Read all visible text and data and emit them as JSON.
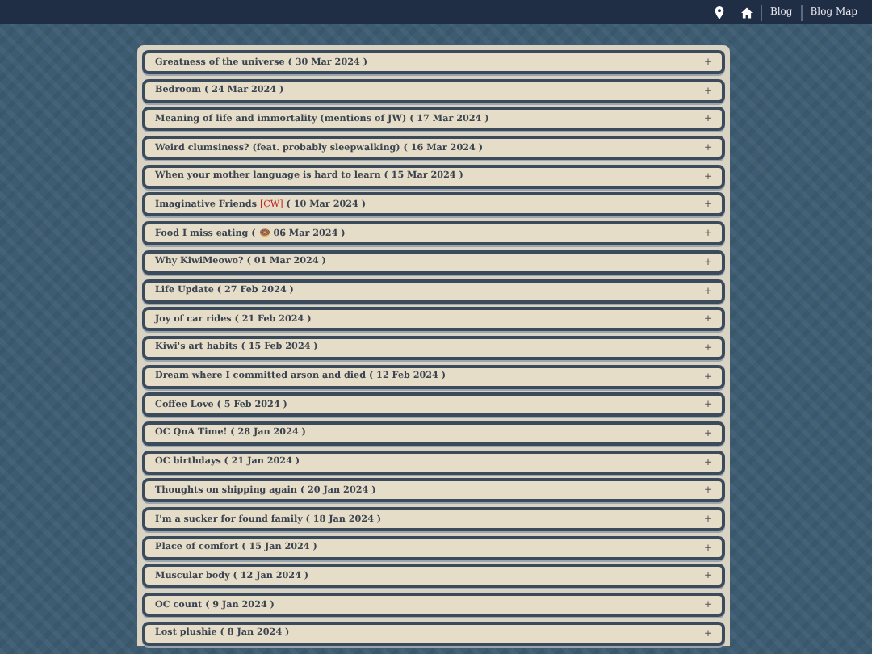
{
  "nav": {
    "links": [
      "Blog",
      "Blog Map"
    ]
  },
  "posts": [
    {
      "title": "Greatness of the universe",
      "date": "( 30 Mar 2024 )",
      "toggle": "+"
    },
    {
      "title": "Bedroom",
      "date": "( 24 Mar 2024 )",
      "toggle": "+"
    },
    {
      "title": "Meaning of life and immortality (mentions of JW)",
      "date": "( 17 Mar 2024 )",
      "toggle": "+"
    },
    {
      "title": "Weird clumsiness? (feat. probably sleepwalking)",
      "date": "( 16 Mar 2024 )",
      "toggle": "+"
    },
    {
      "title": "When your mother language is hard to learn",
      "date": "( 15 Mar 2024 )",
      "toggle": "+"
    },
    {
      "title": "Imaginative Friends",
      "tag": "[CW]",
      "date": "( 10 Mar 2024 )",
      "toggle": "+"
    },
    {
      "title": "Food I miss eating",
      "date": "( 🍩 06 Mar 2024 )",
      "toggle": "+"
    },
    {
      "title": "Why KiwiMeowo?",
      "date": "( 01 Mar 2024 )",
      "toggle": "+"
    },
    {
      "title": "Life Update",
      "date": "( 27 Feb 2024 )",
      "toggle": "+"
    },
    {
      "title": "Joy of car rides",
      "date": "( 21 Feb 2024 )",
      "toggle": "+"
    },
    {
      "title": "Kiwi's art habits",
      "date": "( 15 Feb 2024 )",
      "toggle": "+"
    },
    {
      "title": "Dream where I committed arson and died",
      "date": "( 12 Feb 2024 )",
      "toggle": "+"
    },
    {
      "title": "Coffee Love",
      "date": "( 5 Feb 2024 )",
      "toggle": "+"
    },
    {
      "title": "OC QnA Time!",
      "date": "( 28 Jan 2024 )",
      "toggle": "+"
    },
    {
      "title": "OC birthdays",
      "date": "( 21 Jan 2024 )",
      "toggle": "+"
    },
    {
      "title": "Thoughts on shipping again",
      "date": "( 20 Jan 2024 )",
      "toggle": "+"
    },
    {
      "title": "I'm a sucker for found family",
      "date": "( 18 Jan 2024 )",
      "toggle": "+"
    },
    {
      "title": "Place of comfort",
      "date": "( 15 Jan 2024 )",
      "toggle": "+"
    },
    {
      "title": "Muscular body",
      "date": "( 12 Jan 2024 )",
      "toggle": "+"
    },
    {
      "title": "OC count",
      "date": "( 9 Jan 2024 )",
      "toggle": "+"
    },
    {
      "title": "Lost plushie",
      "date": "( 8 Jan 2024 )",
      "toggle": "+"
    }
  ]
}
